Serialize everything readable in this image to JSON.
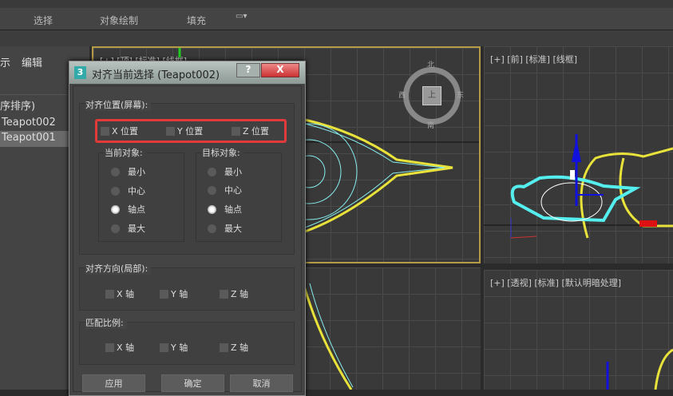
{
  "ribbon": {
    "tabs": [
      "选择",
      "对象绘制",
      "填充"
    ]
  },
  "left_panel": {
    "tab_partial": "示",
    "tab_edit": "编辑",
    "sort_header": "序排序)",
    "items": [
      "Teapot002",
      "Teapot001"
    ],
    "selected": "Teapot001"
  },
  "viewports": {
    "top": {
      "label": "[+] [顶] [标准] [线框]",
      "viewcube": {
        "n": "北",
        "w": "西",
        "e": "东",
        "s": "南",
        "center": "上"
      }
    },
    "front": {
      "label": "[+] [前] [标准] [线框]"
    },
    "perspective": {
      "label": "[+] [透视] [标准] [默认明暗处理]"
    }
  },
  "dialog": {
    "icon": "3",
    "title": "对齐当前选择 (Teapot002)",
    "help": "?",
    "close": "X",
    "align_position": {
      "label": "对齐位置(屏幕):",
      "x": "X 位置",
      "y": "Y 位置",
      "z": "Z 位置"
    },
    "current_object": {
      "label": "当前对象:",
      "options": [
        "最小",
        "中心",
        "轴点",
        "最大"
      ],
      "selected": "轴点"
    },
    "target_object": {
      "label": "目标对象:",
      "options": [
        "最小",
        "中心",
        "轴点",
        "最大"
      ],
      "selected": "轴点"
    },
    "align_orientation": {
      "label": "对齐方向(局部):",
      "x": "X 轴",
      "y": "Y 轴",
      "z": "Z 轴"
    },
    "match_scale": {
      "label": "匹配比例:",
      "x": "X 轴",
      "y": "Y 轴",
      "z": "Z 轴"
    },
    "buttons": {
      "apply": "应用",
      "ok": "确定",
      "cancel": "取消"
    },
    "highlight_color": "#e03a3a"
  }
}
